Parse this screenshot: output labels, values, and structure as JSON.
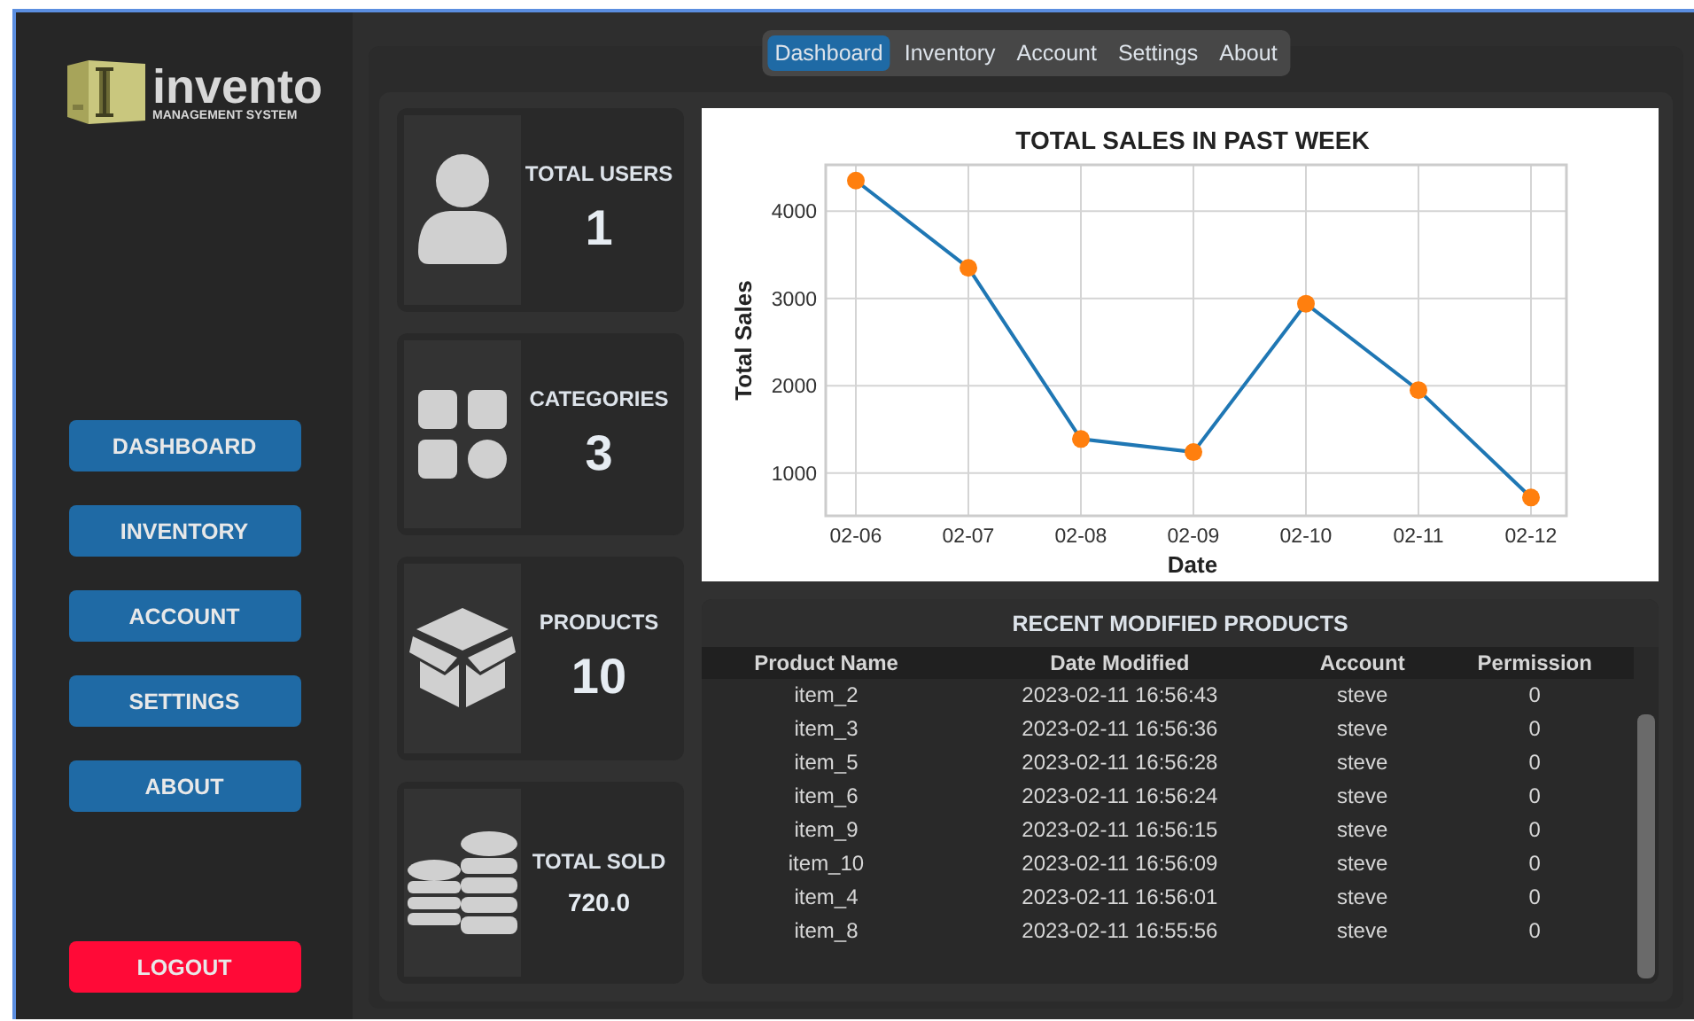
{
  "logo": {
    "name": "invento",
    "tagline": "MANAGEMENT SYSTEM"
  },
  "sidebar": {
    "items": [
      {
        "label": "DASHBOARD",
        "kind": "nav"
      },
      {
        "label": "INVENTORY",
        "kind": "nav"
      },
      {
        "label": "ACCOUNT",
        "kind": "nav"
      },
      {
        "label": "SETTINGS",
        "kind": "nav"
      },
      {
        "label": "ABOUT",
        "kind": "nav"
      },
      {
        "label": "LOGOUT",
        "kind": "logout"
      }
    ]
  },
  "tabs": [
    {
      "label": "Dashboard",
      "selected": true
    },
    {
      "label": "Inventory",
      "selected": false
    },
    {
      "label": "Account",
      "selected": false
    },
    {
      "label": "Settings",
      "selected": false
    },
    {
      "label": "About",
      "selected": false
    }
  ],
  "stats": [
    {
      "kind": "users",
      "label": "TOTAL USERS",
      "value": "1"
    },
    {
      "kind": "categories",
      "label": "CATEGORIES",
      "value": "3"
    },
    {
      "kind": "products",
      "label": "PRODUCTS",
      "value": "10"
    },
    {
      "kind": "sold",
      "label": "TOTAL SOLD",
      "value": "720.0"
    }
  ],
  "sales_chart": {
    "chart_data": {
      "type": "line",
      "title": "TOTAL SALES IN PAST WEEK",
      "xlabel": "Date",
      "ylabel": "Total Sales",
      "categories": [
        "02-06",
        "02-07",
        "02-08",
        "02-09",
        "02-10",
        "02-11",
        "02-12"
      ],
      "series": [
        {
          "color": "#1f77b4",
          "marker": "o",
          "values": [
            4350,
            3350,
            1390,
            1240,
            2940,
            1950,
            720
          ]
        }
      ],
      "grid": true,
      "ylim": [
        510,
        4530
      ],
      "yticks": [
        1000,
        2000,
        3000,
        4000
      ]
    }
  },
  "recent_products": {
    "title": "RECENT MODIFIED PRODUCTS",
    "columns": [
      "Product Name",
      "Date Modified",
      "Account",
      "Permission"
    ],
    "rows": [
      [
        "item_2",
        "2023-02-11 16:56:43",
        "steve",
        "0"
      ],
      [
        "item_3",
        "2023-02-11 16:56:36",
        "steve",
        "0"
      ],
      [
        "item_5",
        "2023-02-11 16:56:28",
        "steve",
        "0"
      ],
      [
        "item_6",
        "2023-02-11 16:56:24",
        "steve",
        "0"
      ],
      [
        "item_9",
        "2023-02-11 16:56:15",
        "steve",
        "0"
      ],
      [
        "item_10",
        "2023-02-11 16:56:09",
        "steve",
        "0"
      ],
      [
        "item_4",
        "2023-02-11 16:56:01",
        "steve",
        "0"
      ],
      [
        "item_8",
        "2023-02-11 16:55:56",
        "steve",
        "0"
      ]
    ]
  }
}
